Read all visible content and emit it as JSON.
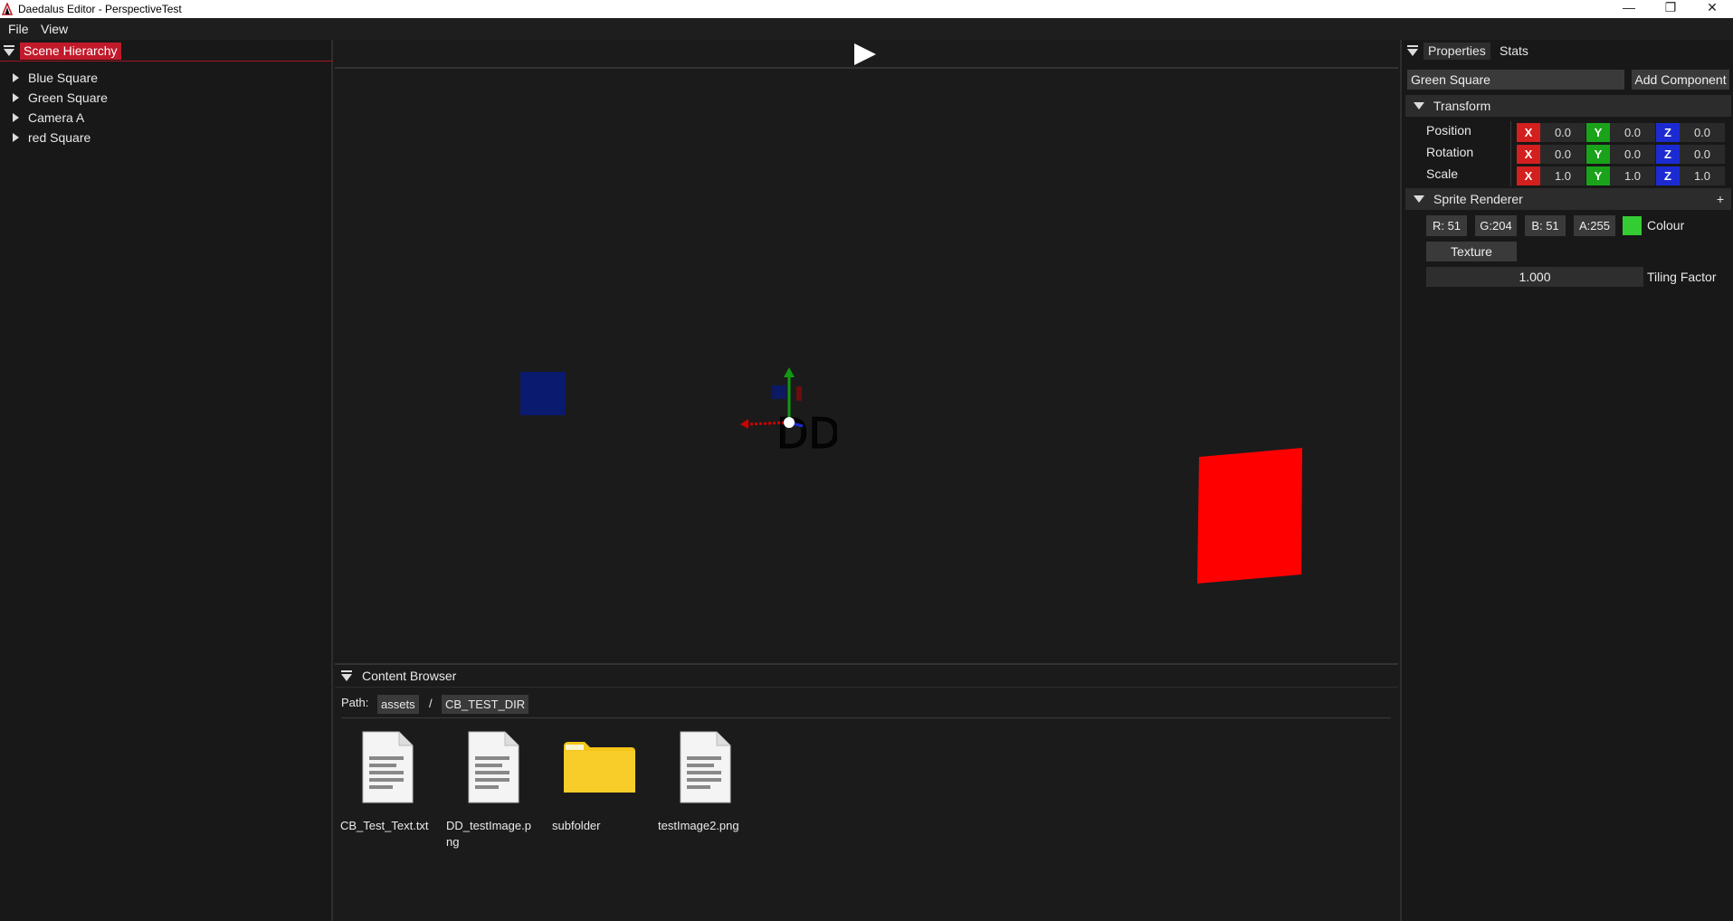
{
  "window": {
    "title": "Daedalus Editor - PerspectiveTest",
    "buttons": [
      "—",
      "❐",
      "✕"
    ]
  },
  "menu": [
    "File",
    "View"
  ],
  "hierarchy": {
    "title": "Scene Hierarchy",
    "items": [
      "Blue Square",
      "Green Square",
      "Camera A",
      "red Square"
    ]
  },
  "viewport": {
    "play_icon": "play-icon",
    "gizmo_label": "DD"
  },
  "content_browser": {
    "title": "Content Browser",
    "path_label": "Path:",
    "path": [
      "assets",
      "CB_TEST_DIR"
    ],
    "separator": "/",
    "files": [
      {
        "name": "CB_Test_Text.txt",
        "icon": "file-icon"
      },
      {
        "name": "DD_testImage.png",
        "icon": "file-icon"
      },
      {
        "name": "subfolder",
        "icon": "folder-icon"
      },
      {
        "name": "testImage2.png",
        "icon": "file-icon"
      }
    ]
  },
  "properties": {
    "tabs": [
      "Properties",
      "Stats"
    ],
    "entity_name": "Green Square",
    "add_component": "Add Component",
    "transform": {
      "title": "Transform",
      "rows": [
        {
          "label": "Position",
          "x": "0.0",
          "y": "0.0",
          "z": "0.0"
        },
        {
          "label": "Rotation",
          "x": "0.0",
          "y": "0.0",
          "z": "0.0"
        },
        {
          "label": "Scale",
          "x": "1.0",
          "y": "1.0",
          "z": "1.0"
        }
      ],
      "axes": [
        "X",
        "Y",
        "Z"
      ]
    },
    "sprite_renderer": {
      "title": "Sprite Renderer",
      "add": "+",
      "r": "R: 51",
      "g": "G:204",
      "b": "B: 51",
      "a": "A:255",
      "colour_label": "Colour",
      "colour": "#33cc33",
      "texture": "Texture",
      "tiling_value": "1.000",
      "tiling_label": "Tiling Factor"
    }
  },
  "colors": {
    "accent": "#c11a2b",
    "blue_square": "#0a1a6e",
    "red_square": "#ff0000"
  }
}
